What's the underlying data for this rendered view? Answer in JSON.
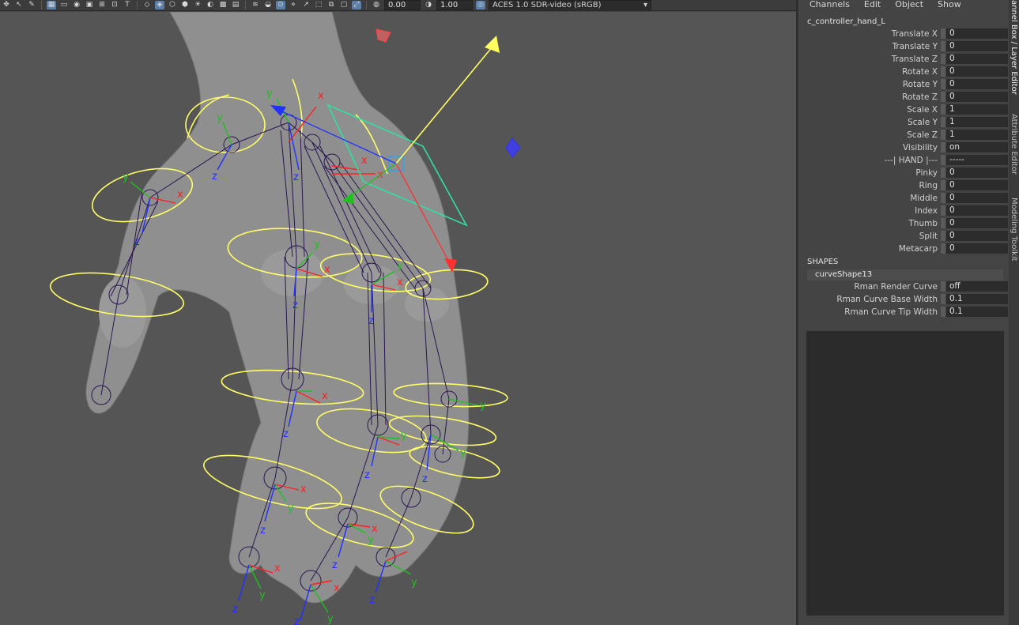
{
  "toolbar": {
    "icons": [
      "move-icon",
      "select-icon",
      "paint-icon",
      "wireframe-icon",
      "smooth-shade-icon",
      "grid-icon",
      "camera-icon",
      "film-gate-icon",
      "resolution-gate-icon",
      "field-chart-icon",
      "safe-action-icon",
      "cube-icon",
      "textured-icon",
      "lights-icon",
      "shadows-icon",
      "ao-icon",
      "motion-blur-icon",
      "aa-icon",
      "isolate-icon",
      "xray-icon",
      "xray-joints-icon",
      "backface-icon"
    ],
    "exposure_value": "0.00",
    "gamma_value": "1.00",
    "color_space": "ACES 1.0 SDR-video (sRGB)"
  },
  "viewport": {
    "axis_labels": {
      "x": "x",
      "y": "y",
      "z": "z"
    },
    "colors": {
      "background": "#555555",
      "mesh": "#8f8f8f",
      "controller": "#ffff66",
      "joint": "#2a1650",
      "axis_x": "#ff2020",
      "axis_y": "#20c020",
      "axis_z": "#2030ff",
      "selected_plane": "#30e0a0",
      "manipulator": "#ffff60"
    }
  },
  "channel_box": {
    "menu": [
      "Channels",
      "Edit",
      "Object",
      "Show"
    ],
    "node_name": "c_controller_hand_L",
    "attributes": [
      {
        "label": "Translate X",
        "value": "0"
      },
      {
        "label": "Translate Y",
        "value": "0"
      },
      {
        "label": "Translate Z",
        "value": "0"
      },
      {
        "label": "Rotate X",
        "value": "0"
      },
      {
        "label": "Rotate Y",
        "value": "0"
      },
      {
        "label": "Rotate Z",
        "value": "0"
      },
      {
        "label": "Scale X",
        "value": "1"
      },
      {
        "label": "Scale Y",
        "value": "1"
      },
      {
        "label": "Scale Z",
        "value": "1"
      },
      {
        "label": "Visibility",
        "value": "on"
      },
      {
        "label": "---| HAND |---",
        "value": "-----"
      },
      {
        "label": "Pinky",
        "value": "0"
      },
      {
        "label": "Ring",
        "value": "0"
      },
      {
        "label": "Middle",
        "value": "0"
      },
      {
        "label": "Index",
        "value": "0"
      },
      {
        "label": "Thumb",
        "value": "0"
      },
      {
        "label": "Split",
        "value": "0"
      },
      {
        "label": "Metacarp",
        "value": "0"
      }
    ],
    "shapes_title": "SHAPES",
    "shape_node": "curveShape13",
    "shape_attributes": [
      {
        "label": "Rman Render Curve",
        "value": "off"
      },
      {
        "label": "Rman Curve Base Width",
        "value": "0.1"
      },
      {
        "label": "Rman Curve Tip Width",
        "value": "0.1"
      }
    ]
  },
  "side_tabs": [
    "annel Box / Layer Editor",
    "Attribute Editor",
    "Modeling Toolkit"
  ]
}
